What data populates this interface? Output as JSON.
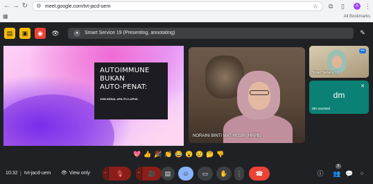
{
  "browser": {
    "url": "meet.google.com/tvt-jacd-uem",
    "all_bookmarks": "All Bookmarks",
    "profile_initial": "A"
  },
  "topbar": {
    "presenting_text": "Smart Service 19 (Presenting, annotating)"
  },
  "slide": {
    "title_lines": [
      "AUTOIMMUNE",
      "BUKAN",
      "AUTO-PENAT:"
    ],
    "subtitle": "JOM KENAL APA ITU LUPUS"
  },
  "tiles": {
    "main_speaker_name": "NORAINI BINTI MAT HUSIN (HRPB)",
    "tile_a_name": "Smart Service 19",
    "tile_b_initials": "dm",
    "tile_b_name": "dm socmed"
  },
  "reactions": [
    "💖",
    "👍",
    "🎉",
    "👏",
    "😂",
    "😮",
    "😢",
    "🤔",
    "👎"
  ],
  "bottombar": {
    "time": "10:32",
    "separator": "|",
    "meeting_code": "tvt-jacd-uem",
    "view_label": "View only",
    "people_count": "5"
  },
  "icons": {
    "back": "←",
    "forward": "→",
    "reload": "↻",
    "site": "⚙",
    "star": "☆",
    "apps": "▦",
    "pen": "✎",
    "eye": "👁",
    "mic_off": "🎙",
    "cam_off": "🎥",
    "captions": "▤",
    "emoji": "☺",
    "present": "▭",
    "hand": "✋",
    "more": "⋮",
    "end_call": "☎",
    "info": "ⓘ",
    "people": "👥",
    "chat": "💬",
    "activities": "⁘"
  },
  "colors": {
    "meet_bg": "#202124",
    "end_call": "#ea4335",
    "emoji_active": "#8ab4f8",
    "tile_b": "#0b8074"
  }
}
